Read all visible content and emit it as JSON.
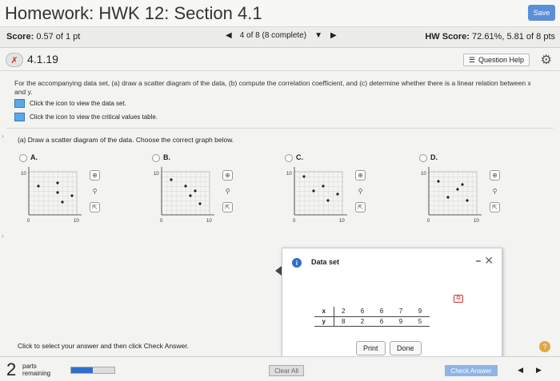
{
  "header": {
    "title": "Homework: HWK 12: Section 4.1",
    "save_label": "Save"
  },
  "scorebar": {
    "score_label": "Score:",
    "score_value": "0.57 of 1 pt",
    "nav_text": "4 of 8 (8 complete)",
    "hw_label": "HW Score:",
    "hw_value": "72.61%, 5.81 of 8 pts"
  },
  "question": {
    "number": "4.1.19",
    "help_label": "Question Help",
    "body": "For the accompanying data set, (a) draw a scatter diagram of the data, (b) compute the correlation coefficient, and (c) determine whether there is a linear relation between x and y.",
    "icon_line1": "Click the icon to view the data set.",
    "icon_line2": "Click the icon to view the critical values table.",
    "prompt": "(a) Draw a scatter diagram of the data. Choose the correct graph below."
  },
  "options": [
    {
      "label": "A.",
      "ytick": "10",
      "x0": "0",
      "x10": "10"
    },
    {
      "label": "B.",
      "ytick": "10",
      "x0": "0",
      "x10": "10"
    },
    {
      "label": "C.",
      "ytick": "10",
      "x0": "0",
      "x10": "10"
    },
    {
      "label": "D.",
      "ytick": "10",
      "x0": "0",
      "x10": "10"
    }
  ],
  "popup": {
    "title": "Data set",
    "x_label": "x",
    "y_label": "y",
    "x_values": [
      "2",
      "6",
      "6",
      "7",
      "9"
    ],
    "y_values": [
      "8",
      "2",
      "6",
      "9",
      "5"
    ],
    "print_label": "Print",
    "done_label": "Done"
  },
  "footer": {
    "instruction": "Click to select your answer and then click Check Answer.",
    "parts_count": "2",
    "parts_label_1": "parts",
    "parts_label_2": "remaining",
    "progress_fraction": 0.5,
    "clear_label": "Clear All",
    "check_label": "Check Answer"
  },
  "colors": {
    "accent": "#2f6fc9",
    "save": "#5b8fd6",
    "icon_blue": "#5ba9e8"
  }
}
